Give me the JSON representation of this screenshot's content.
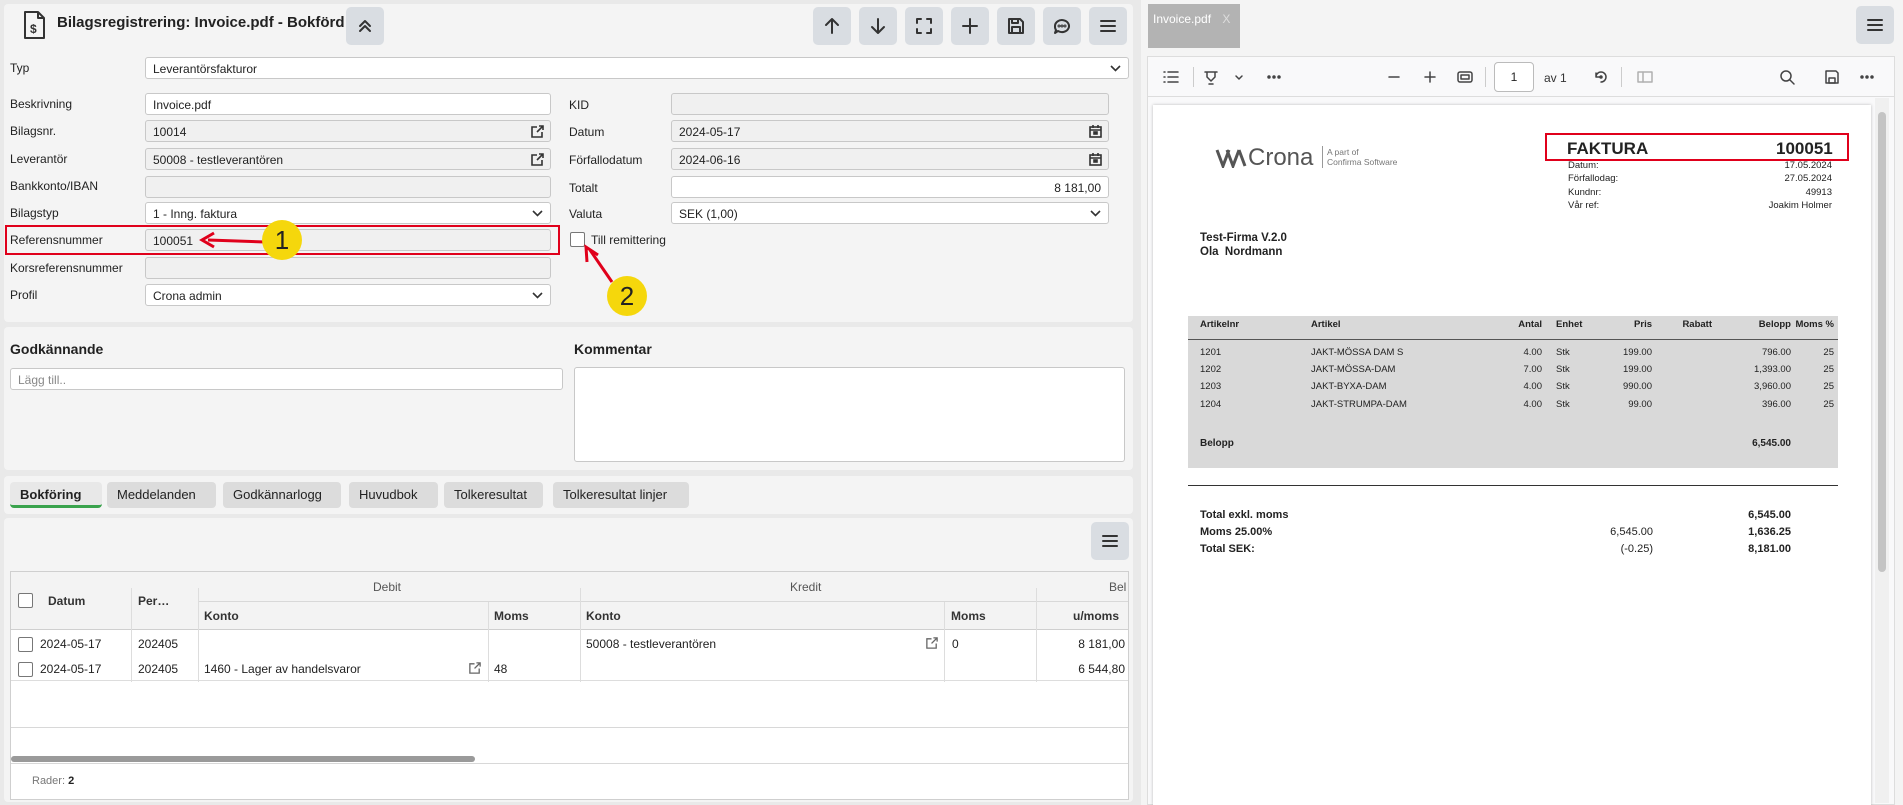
{
  "header": {
    "title": "Bilagsregistrering: Invoice.pdf - Bokförd"
  },
  "form": {
    "typ_label": "Typ",
    "typ_value": "Leverantörsfakturor",
    "beskrivning_label": "Beskrivning",
    "beskrivning_value": "Invoice.pdf",
    "bilagsnr_label": "Bilagsnr.",
    "bilagsnr_value": "10014",
    "leverantor_label": "Leverantör",
    "leverantor_value": "50008 - testleverantören",
    "bankkonto_label": "Bankkonto/IBAN",
    "bankkonto_value": "",
    "bilagstyp_label": "Bilagstyp",
    "bilagstyp_value": "1 - Inng. faktura",
    "referens_label": "Referensnummer",
    "referens_value": "100051",
    "korsref_label": "Korsreferensnummer",
    "korsref_value": "",
    "profil_label": "Profil",
    "profil_value": "Crona admin",
    "kid_label": "KID",
    "kid_value": "",
    "datum_label": "Datum",
    "datum_value": "2024-05-17",
    "forfallo_label": "Förfallodatum",
    "forfallo_value": "2024-06-16",
    "totalt_label": "Totalt",
    "totalt_value": "8 181,00",
    "valuta_label": "Valuta",
    "valuta_value": "SEK (1,00)",
    "remittering_label": "Till remittering"
  },
  "annotations": {
    "marker1": "1",
    "marker2": "2"
  },
  "approval": {
    "godkannande_label": "Godkännande",
    "add_placeholder": "Lägg till..",
    "kommentar_label": "Kommentar"
  },
  "tabs": [
    "Bokföring",
    "Meddelanden",
    "Godkännarlogg",
    "Huvudbok",
    "Tolkeresultat",
    "Tolkeresultat linjer"
  ],
  "grid": {
    "col_datum": "Datum",
    "col_per": "Per…",
    "group_debit": "Debit",
    "group_kredit": "Kredit",
    "group_bel": "Bel",
    "col_debit_konto": "Konto",
    "col_debit_moms": "Moms",
    "col_kredit_konto": "Konto",
    "col_kredit_moms": "Moms",
    "col_umoms": "u/moms",
    "rows": [
      {
        "datum": "2024-05-17",
        "per": "202405",
        "debit_konto": "",
        "debit_moms": "",
        "kredit_konto": "50008 - testleverantören",
        "kredit_moms": "0",
        "umoms": "8 181,00"
      },
      {
        "datum": "2024-05-17",
        "per": "202405",
        "debit_konto": "1460 - Lager av handelsvaror",
        "debit_moms": "48",
        "kredit_konto": "",
        "kredit_moms": "",
        "umoms": "6 544,80"
      }
    ],
    "footer_label": "Rader:",
    "footer_count": "2"
  },
  "viewer": {
    "tab_label": "Invoice.pdf",
    "tab_close": "X",
    "page_input": "1",
    "page_of": "av 1"
  },
  "invoice": {
    "logo_text": "Crona",
    "logo_sub1": "A part of",
    "logo_sub2": "Confirma Software",
    "title": "FAKTURA",
    "number": "100051",
    "meta": [
      {
        "label": "Datum:",
        "value": "17.05.2024"
      },
      {
        "label": "Förfallodag:",
        "value": "27.05.2024"
      },
      {
        "label": "Kundnr:",
        "value": "49913"
      },
      {
        "label": "Vår ref:",
        "value": "Joakim Holmer"
      }
    ],
    "customer_line1": "Test-Firma V.2.0",
    "customer_line2": "Ola  Nordmann",
    "columns": [
      "Artikelnr",
      "Artikel",
      "Antal",
      "Enhet",
      "Pris",
      "Rabatt",
      "Belopp",
      "Moms %"
    ],
    "lines": [
      {
        "nr": "1201",
        "artikel": "JAKT-MÖSSA DAM S",
        "antal": "4.00",
        "enhet": "Stk",
        "pris": "199.00",
        "rabatt": "",
        "belopp": "796.00",
        "moms": "25"
      },
      {
        "nr": "1202",
        "artikel": "JAKT-MÖSSA-DAM",
        "antal": "7.00",
        "enhet": "Stk",
        "pris": "199.00",
        "rabatt": "",
        "belopp": "1,393.00",
        "moms": "25"
      },
      {
        "nr": "1203",
        "artikel": "JAKT-BYXA-DAM",
        "antal": "4.00",
        "enhet": "Stk",
        "pris": "990.00",
        "rabatt": "",
        "belopp": "3,960.00",
        "moms": "25"
      },
      {
        "nr": "1204",
        "artikel": "JAKT-STRUMPA-DAM",
        "antal": "4.00",
        "enhet": "Stk",
        "pris": "99.00",
        "rabatt": "",
        "belopp": "396.00",
        "moms": "25"
      }
    ],
    "belopp_label": "Belopp",
    "belopp_value": "6,545.00",
    "total_exkl_label": "Total exkl. moms",
    "total_exkl_value": "6,545.00",
    "moms_label": "Moms 25.00%",
    "moms_base": "6,545.00",
    "moms_value": "1,636.25",
    "total_sek_label": "Total SEK:",
    "rounding": "(-0.25)",
    "total_sek_value": "8,181.00"
  },
  "colors": {
    "accent_green": "#3aa34d",
    "highlight_red": "#e0001b",
    "marker_yellow": "#f5d70c"
  }
}
